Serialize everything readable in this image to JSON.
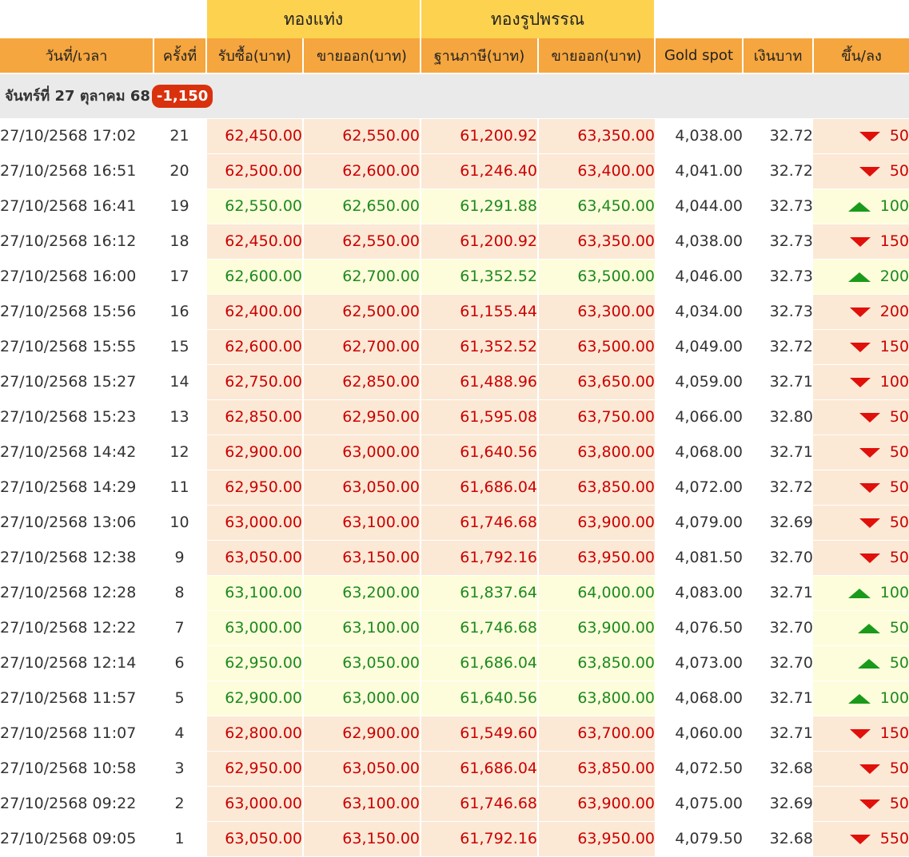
{
  "groups": {
    "bar": "ทองแท่ง",
    "ornament": "ทองรูปพรรณ"
  },
  "columns": {
    "datetime": "วันที่/เวลา",
    "round": "ครั้งที่",
    "bar_buy": "รับซื้อ(บาท)",
    "bar_sell": "ขายออก(บาท)",
    "ornament_tax_base": "ฐานภาษี(บาท)",
    "ornament_sell": "ขายออก(บาท)",
    "gold_spot": "Gold spot",
    "thb": "เงินบาท",
    "change": "ขึ้น/ลง"
  },
  "day": {
    "label": "จันทร์ที่ 27 ตุลาคม 68",
    "total_change": "-1,150"
  },
  "colors": {
    "group_header": "#fdd24f",
    "column_header": "#f5a63e",
    "down_bg": "#fbe9d6",
    "up_bg": "#fdfddc",
    "down_text": "#cc0000",
    "up_text": "#1d8a1d",
    "badge": "#d9310d"
  },
  "rows": [
    {
      "datetime": "27/10/2568 17:02",
      "round": "21",
      "bar_buy": "62,450.00",
      "bar_sell": "62,550.00",
      "tax_base": "61,200.92",
      "orn_sell": "63,350.00",
      "spot": "4,038.00",
      "thb": "32.72",
      "change": "50",
      "direction": "down",
      "arrow_icon": "down-triangle-icon"
    },
    {
      "datetime": "27/10/2568 16:51",
      "round": "20",
      "bar_buy": "62,500.00",
      "bar_sell": "62,600.00",
      "tax_base": "61,246.40",
      "orn_sell": "63,400.00",
      "spot": "4,041.00",
      "thb": "32.72",
      "change": "50",
      "direction": "down",
      "arrow_icon": "down-triangle-icon"
    },
    {
      "datetime": "27/10/2568 16:41",
      "round": "19",
      "bar_buy": "62,550.00",
      "bar_sell": "62,650.00",
      "tax_base": "61,291.88",
      "orn_sell": "63,450.00",
      "spot": "4,044.00",
      "thb": "32.73",
      "change": "100",
      "direction": "up",
      "arrow_icon": "up-triangle-icon"
    },
    {
      "datetime": "27/10/2568 16:12",
      "round": "18",
      "bar_buy": "62,450.00",
      "bar_sell": "62,550.00",
      "tax_base": "61,200.92",
      "orn_sell": "63,350.00",
      "spot": "4,038.00",
      "thb": "32.73",
      "change": "150",
      "direction": "down",
      "arrow_icon": "down-triangle-icon"
    },
    {
      "datetime": "27/10/2568 16:00",
      "round": "17",
      "bar_buy": "62,600.00",
      "bar_sell": "62,700.00",
      "tax_base": "61,352.52",
      "orn_sell": "63,500.00",
      "spot": "4,046.00",
      "thb": "32.73",
      "change": "200",
      "direction": "up",
      "arrow_icon": "up-triangle-icon"
    },
    {
      "datetime": "27/10/2568 15:56",
      "round": "16",
      "bar_buy": "62,400.00",
      "bar_sell": "62,500.00",
      "tax_base": "61,155.44",
      "orn_sell": "63,300.00",
      "spot": "4,034.00",
      "thb": "32.73",
      "change": "200",
      "direction": "down",
      "arrow_icon": "down-triangle-icon"
    },
    {
      "datetime": "27/10/2568 15:55",
      "round": "15",
      "bar_buy": "62,600.00",
      "bar_sell": "62,700.00",
      "tax_base": "61,352.52",
      "orn_sell": "63,500.00",
      "spot": "4,049.00",
      "thb": "32.72",
      "change": "150",
      "direction": "down",
      "arrow_icon": "down-triangle-icon"
    },
    {
      "datetime": "27/10/2568 15:27",
      "round": "14",
      "bar_buy": "62,750.00",
      "bar_sell": "62,850.00",
      "tax_base": "61,488.96",
      "orn_sell": "63,650.00",
      "spot": "4,059.00",
      "thb": "32.71",
      "change": "100",
      "direction": "down",
      "arrow_icon": "down-triangle-icon"
    },
    {
      "datetime": "27/10/2568 15:23",
      "round": "13",
      "bar_buy": "62,850.00",
      "bar_sell": "62,950.00",
      "tax_base": "61,595.08",
      "orn_sell": "63,750.00",
      "spot": "4,066.00",
      "thb": "32.80",
      "change": "50",
      "direction": "down",
      "arrow_icon": "down-triangle-icon"
    },
    {
      "datetime": "27/10/2568 14:42",
      "round": "12",
      "bar_buy": "62,900.00",
      "bar_sell": "63,000.00",
      "tax_base": "61,640.56",
      "orn_sell": "63,800.00",
      "spot": "4,068.00",
      "thb": "32.71",
      "change": "50",
      "direction": "down",
      "arrow_icon": "down-triangle-icon"
    },
    {
      "datetime": "27/10/2568 14:29",
      "round": "11",
      "bar_buy": "62,950.00",
      "bar_sell": "63,050.00",
      "tax_base": "61,686.04",
      "orn_sell": "63,850.00",
      "spot": "4,072.00",
      "thb": "32.72",
      "change": "50",
      "direction": "down",
      "arrow_icon": "down-triangle-icon"
    },
    {
      "datetime": "27/10/2568 13:06",
      "round": "10",
      "bar_buy": "63,000.00",
      "bar_sell": "63,100.00",
      "tax_base": "61,746.68",
      "orn_sell": "63,900.00",
      "spot": "4,079.00",
      "thb": "32.69",
      "change": "50",
      "direction": "down",
      "arrow_icon": "down-triangle-icon"
    },
    {
      "datetime": "27/10/2568 12:38",
      "round": "9",
      "bar_buy": "63,050.00",
      "bar_sell": "63,150.00",
      "tax_base": "61,792.16",
      "orn_sell": "63,950.00",
      "spot": "4,081.50",
      "thb": "32.70",
      "change": "50",
      "direction": "down",
      "arrow_icon": "down-triangle-icon"
    },
    {
      "datetime": "27/10/2568 12:28",
      "round": "8",
      "bar_buy": "63,100.00",
      "bar_sell": "63,200.00",
      "tax_base": "61,837.64",
      "orn_sell": "64,000.00",
      "spot": "4,083.00",
      "thb": "32.71",
      "change": "100",
      "direction": "up",
      "arrow_icon": "up-triangle-icon"
    },
    {
      "datetime": "27/10/2568 12:22",
      "round": "7",
      "bar_buy": "63,000.00",
      "bar_sell": "63,100.00",
      "tax_base": "61,746.68",
      "orn_sell": "63,900.00",
      "spot": "4,076.50",
      "thb": "32.70",
      "change": "50",
      "direction": "up",
      "arrow_icon": "up-triangle-icon"
    },
    {
      "datetime": "27/10/2568 12:14",
      "round": "6",
      "bar_buy": "62,950.00",
      "bar_sell": "63,050.00",
      "tax_base": "61,686.04",
      "orn_sell": "63,850.00",
      "spot": "4,073.00",
      "thb": "32.70",
      "change": "50",
      "direction": "up",
      "arrow_icon": "up-triangle-icon"
    },
    {
      "datetime": "27/10/2568 11:57",
      "round": "5",
      "bar_buy": "62,900.00",
      "bar_sell": "63,000.00",
      "tax_base": "61,640.56",
      "orn_sell": "63,800.00",
      "spot": "4,068.00",
      "thb": "32.71",
      "change": "100",
      "direction": "up",
      "arrow_icon": "up-triangle-icon"
    },
    {
      "datetime": "27/10/2568 11:07",
      "round": "4",
      "bar_buy": "62,800.00",
      "bar_sell": "62,900.00",
      "tax_base": "61,549.60",
      "orn_sell": "63,700.00",
      "spot": "4,060.00",
      "thb": "32.71",
      "change": "150",
      "direction": "down",
      "arrow_icon": "down-triangle-icon"
    },
    {
      "datetime": "27/10/2568 10:58",
      "round": "3",
      "bar_buy": "62,950.00",
      "bar_sell": "63,050.00",
      "tax_base": "61,686.04",
      "orn_sell": "63,850.00",
      "spot": "4,072.50",
      "thb": "32.68",
      "change": "50",
      "direction": "down",
      "arrow_icon": "down-triangle-icon"
    },
    {
      "datetime": "27/10/2568 09:22",
      "round": "2",
      "bar_buy": "63,000.00",
      "bar_sell": "63,100.00",
      "tax_base": "61,746.68",
      "orn_sell": "63,900.00",
      "spot": "4,075.00",
      "thb": "32.69",
      "change": "50",
      "direction": "down",
      "arrow_icon": "down-triangle-icon"
    },
    {
      "datetime": "27/10/2568 09:05",
      "round": "1",
      "bar_buy": "63,050.00",
      "bar_sell": "63,150.00",
      "tax_base": "61,792.16",
      "orn_sell": "63,950.00",
      "spot": "4,079.50",
      "thb": "32.68",
      "change": "550",
      "direction": "down",
      "arrow_icon": "down-triangle-icon"
    }
  ]
}
